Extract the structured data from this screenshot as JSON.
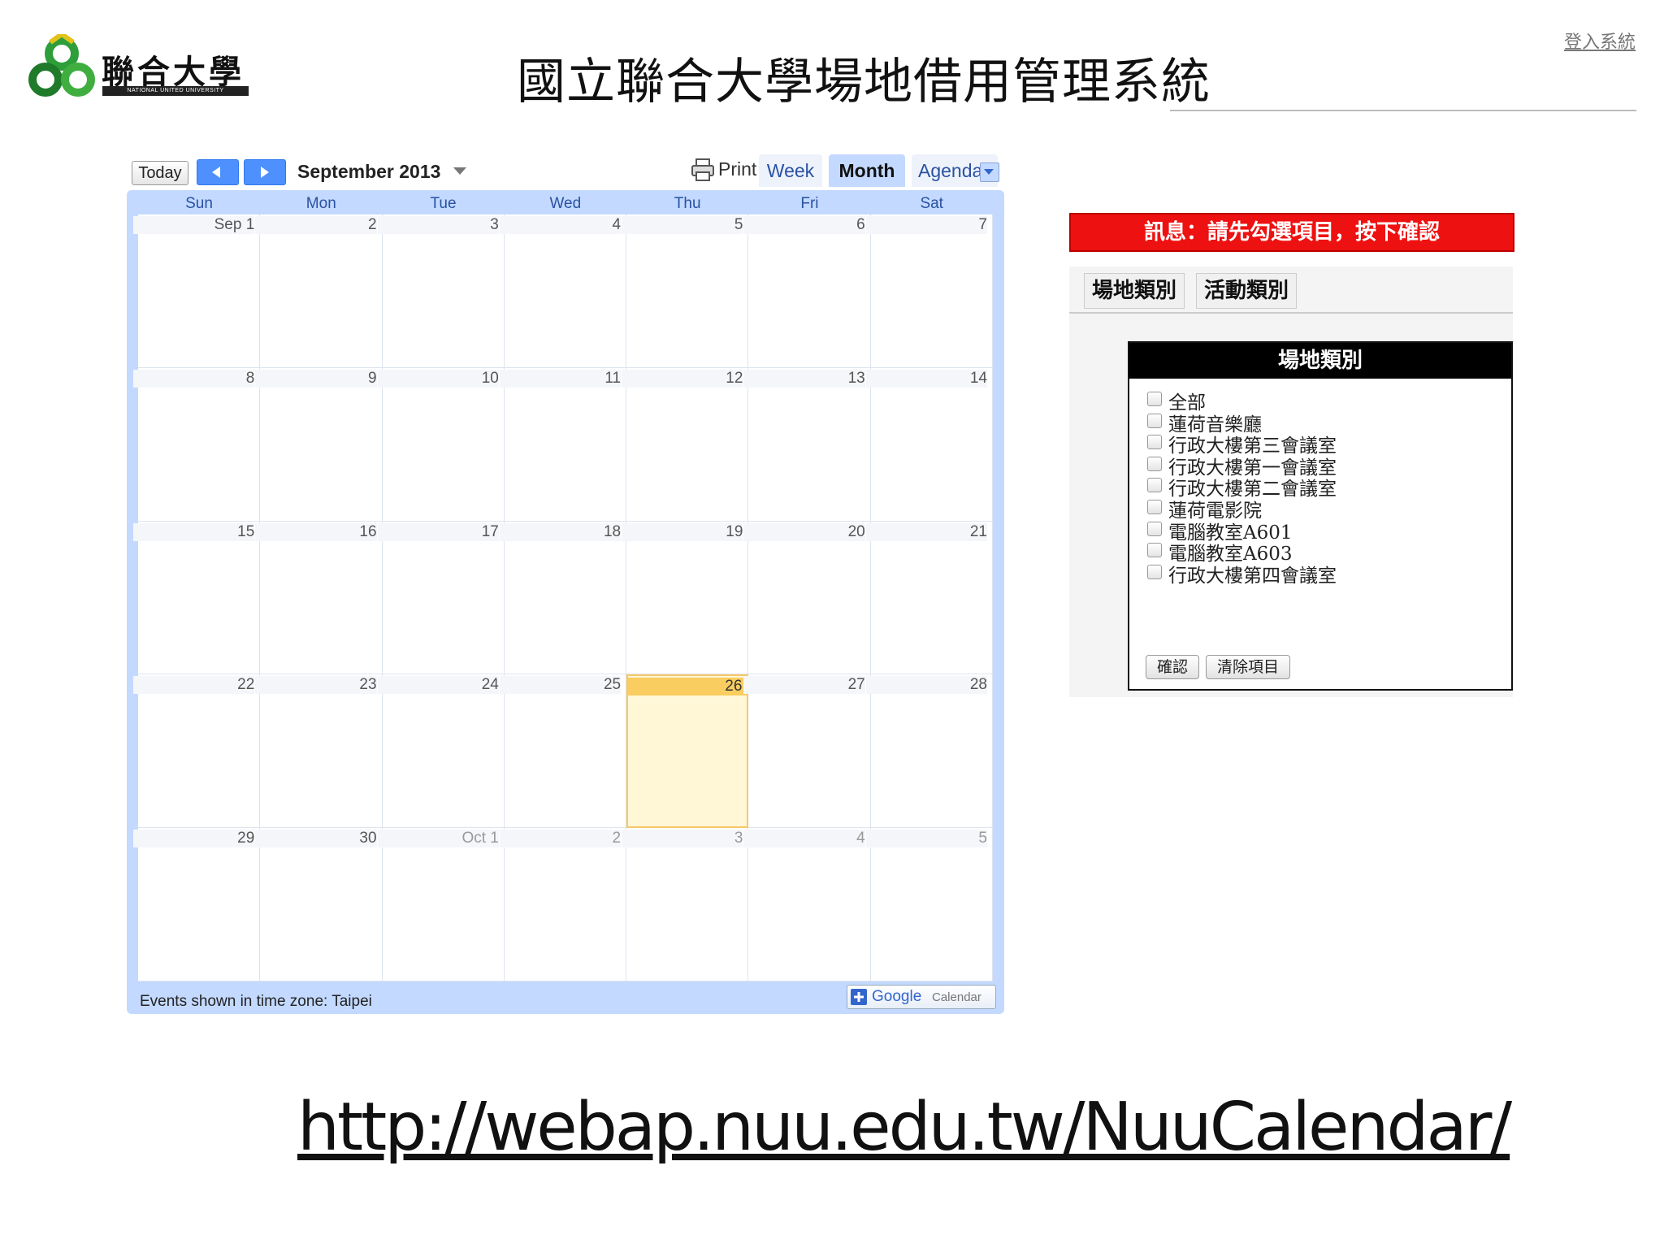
{
  "header": {
    "logo_text": "聯合大學",
    "logo_subtext": "NATIONAL UNITED UNIVERSITY",
    "title": "國立聯合大學場地借用管理系統",
    "login_link": "登入系統"
  },
  "calendar": {
    "today_label": "Today",
    "month_label": "September 2013",
    "print_label": "Print",
    "views": {
      "week": "Week",
      "month": "Month",
      "agenda": "Agenda"
    },
    "active_view": "Month",
    "weekdays": [
      "Sun",
      "Mon",
      "Tue",
      "Wed",
      "Thu",
      "Fri",
      "Sat"
    ],
    "weeks": [
      [
        {
          "label": "Sep 1"
        },
        {
          "label": "2"
        },
        {
          "label": "3"
        },
        {
          "label": "4"
        },
        {
          "label": "5"
        },
        {
          "label": "6"
        },
        {
          "label": "7"
        }
      ],
      [
        {
          "label": "8"
        },
        {
          "label": "9"
        },
        {
          "label": "10"
        },
        {
          "label": "11"
        },
        {
          "label": "12"
        },
        {
          "label": "13"
        },
        {
          "label": "14"
        }
      ],
      [
        {
          "label": "15"
        },
        {
          "label": "16"
        },
        {
          "label": "17"
        },
        {
          "label": "18"
        },
        {
          "label": "19"
        },
        {
          "label": "20"
        },
        {
          "label": "21"
        }
      ],
      [
        {
          "label": "22"
        },
        {
          "label": "23"
        },
        {
          "label": "24"
        },
        {
          "label": "25"
        },
        {
          "label": "26",
          "today": true
        },
        {
          "label": "27"
        },
        {
          "label": "28"
        }
      ],
      [
        {
          "label": "29"
        },
        {
          "label": "30"
        },
        {
          "label": "Oct 1",
          "other": true
        },
        {
          "label": "2",
          "other": true
        },
        {
          "label": "3",
          "other": true
        },
        {
          "label": "4",
          "other": true
        },
        {
          "label": "5",
          "other": true
        }
      ]
    ],
    "timezone_note": "Events shown in time zone: Taipei",
    "gcal_button": {
      "google": "Google",
      "calendar": "Calendar"
    },
    "colors": {
      "frame": "#c3d9ff",
      "today_bg": "#fff7d6",
      "today_header": "#f9cd5f",
      "link": "#2952a3"
    }
  },
  "panel": {
    "message": "訊息：請先勾選項目，按下確認",
    "tabs": [
      "場地類別",
      "活動類別"
    ],
    "box_title": "場地類別",
    "options": [
      {
        "label": "全部",
        "checked": false
      },
      {
        "label": "蓮荷音樂廳",
        "checked": false
      },
      {
        "label": "行政大樓第三會議室",
        "checked": false
      },
      {
        "label": "行政大樓第一會議室",
        "checked": false
      },
      {
        "label": "行政大樓第二會議室",
        "checked": false
      },
      {
        "label": "蓮荷電影院",
        "checked": false
      },
      {
        "label": "電腦教室A601",
        "checked": false
      },
      {
        "label": "電腦教室A603",
        "checked": false
      },
      {
        "label": "行政大樓第四會議室",
        "checked": false
      }
    ],
    "confirm_label": "確認",
    "clear_label": "清除項目",
    "colors": {
      "message_bg": "#ee1111"
    }
  },
  "url": "http://webap.nuu.edu.tw/NuuCalendar/"
}
